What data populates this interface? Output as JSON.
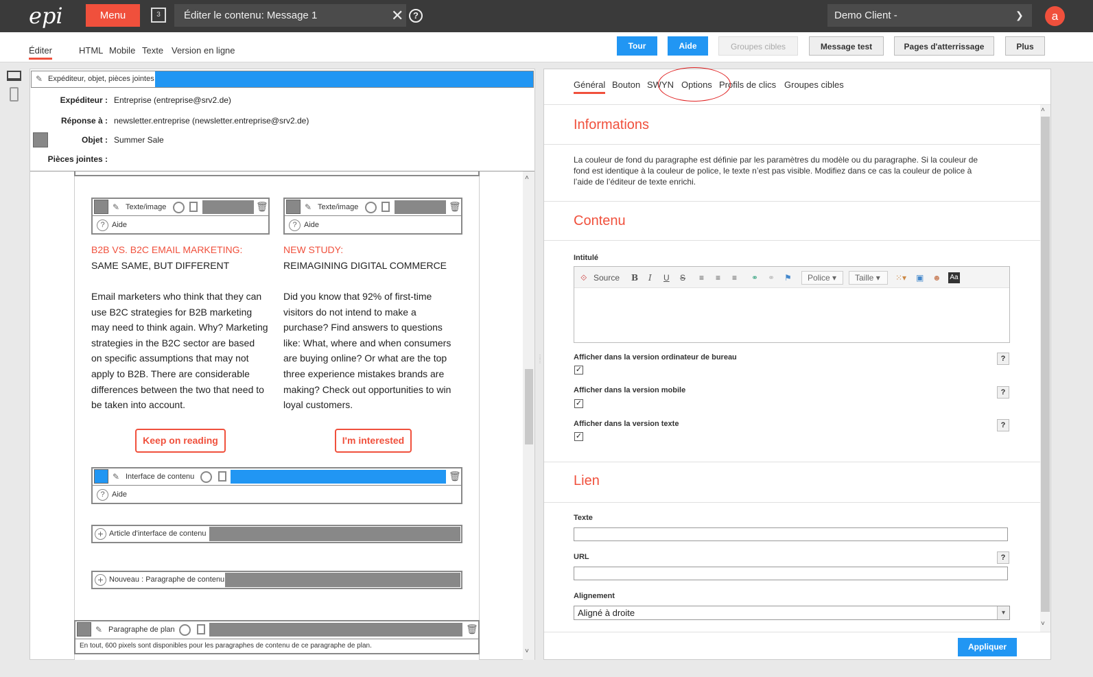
{
  "topbar": {
    "logo_text": "epi",
    "menu_label": "Menu",
    "tab_count": "3",
    "title": "Éditer le contenu: Message 1",
    "client": "Demo Client -",
    "user_initial": "a",
    "accent_color": "#f0503c"
  },
  "subbar": {
    "tabs": [
      "Éditer",
      "HTML",
      "Mobile",
      "Texte",
      "Version en ligne"
    ],
    "buttons": [
      "Tour",
      "Aide",
      "Groupes cibles",
      "Message test",
      "Pages d'atterrissage",
      "Plus"
    ],
    "primary_color": "#2196f3"
  },
  "header_section": {
    "bar_label": "Expéditeur, objet, pièces jointes",
    "sender_label": "Expéditeur :",
    "sender_value": "Entreprise (entreprise@srv2.de)",
    "reply_label": "Réponse à :",
    "reply_value": "newsletter.entreprise (newsletter.entreprise@srv2.de)",
    "subject_label": "Objet :",
    "subject_value": "Summer Sale",
    "attach_label": "Pièces jointes :"
  },
  "blocks": {
    "text_image_label": "Texte/image",
    "help_label": "Aide",
    "content_interface_label": "Interface de contenu",
    "add_article_label": "Article d'interface de contenu",
    "add_paragraph_label": "Nouveau : Paragraphe de contenu",
    "plan_label": "Paragraphe de plan",
    "plan_info": "En tout, 600 pixels sont disponibles pour les paragraphes de contenu de ce paragraphe de plan."
  },
  "articles": [
    {
      "kicker": "B2B VS. B2C EMAIL MARKETING:",
      "headline": "SAME SAME, BUT DIFFERENT",
      "lines": [
        "Email marketers who think that they can",
        "use B2C strategies for B2B marketing",
        "may need to think again. Why? Marketing",
        "strategies in the B2C sector are based",
        "on specific assumptions that may not",
        "apply to B2B. There are considerable",
        "differences between the two that need to",
        "be taken into account."
      ],
      "cta": "Keep on reading"
    },
    {
      "kicker": "NEW STUDY:",
      "headline": "REIMAGINING DIGITAL COMMERCE",
      "lines": [
        "Did you know that 92% of first-time",
        "visitors do not intend to make a",
        "purchase? Find answers to questions",
        "like: What, where and when consumers",
        "are buying online? Or what are the top",
        "three experience mistakes brands are",
        "making? Check out opportunities to win",
        "loyal customers."
      ],
      "cta": "I'm interested"
    }
  ],
  "right": {
    "tabs": [
      "Général",
      "Bouton",
      "SWYN",
      "Options",
      "Profils de clics",
      "Groupes cibles"
    ],
    "info_title": "Informations",
    "info_lines": [
      "La couleur de fond du paragraphe est définie par les paramètres du modèle ou du paragraphe. Si la couleur de",
      "fond est identique à la couleur de police, le texte n’est pas visible. Modifiez dans ce cas la couleur de police à",
      "l’aide de l’éditeur de texte enrichi."
    ],
    "content_title": "Contenu",
    "heading_label": "Intitulé",
    "editor": {
      "source": "Source",
      "bold": "B",
      "italic": "I",
      "underline": "U",
      "strike": "S",
      "font_label": "Police",
      "size_label": "Taille",
      "aa": "Aa"
    },
    "show_desktop": "Afficher dans la version ordinateur de bureau",
    "show_mobile": "Afficher dans la version mobile",
    "show_text": "Afficher dans la version texte",
    "link_title": "Lien",
    "text_label": "Texte",
    "url_label": "URL",
    "alignment_label": "Alignement",
    "alignment_value": "Aligné à droite",
    "apply": "Appliquer",
    "q": "?"
  }
}
